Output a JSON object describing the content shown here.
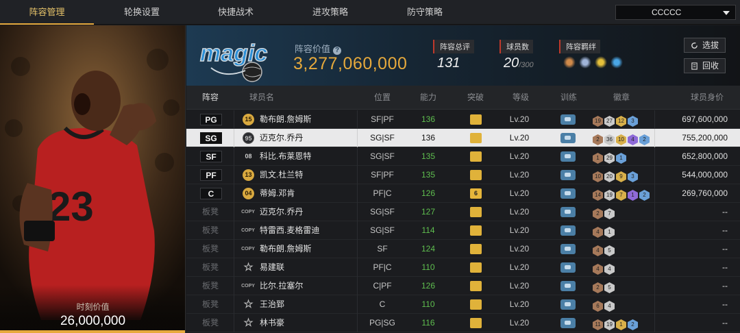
{
  "nav": {
    "tabs": [
      "阵容管理",
      "轮换设置",
      "快捷战术",
      "进攻策略",
      "防守策略"
    ],
    "active_tab": 0,
    "lineup_select": "CCCCC"
  },
  "left_card": {
    "title": "时刻价值",
    "value": "26,000,000",
    "jersey_number": "23"
  },
  "header": {
    "team_logo_text": "magic",
    "lineup_value_label": "阵容价值",
    "lineup_value": "3,277,060,000",
    "rating_label": "阵容总评",
    "rating_value": "131",
    "players_label": "球员数",
    "players_value": "20",
    "players_max": "/300",
    "chemistry_label": "阵容羁绊",
    "filter_button": "选拔",
    "recycle_button": "回收"
  },
  "table": {
    "columns": [
      "阵容",
      "球员名",
      "位置",
      "能力",
      "突破",
      "等级",
      "训练",
      "徽章",
      "球员身价"
    ],
    "rows": [
      {
        "slot": "PG",
        "starter": true,
        "badge": "15",
        "badge_style": "gold",
        "name": "勒布朗.詹姆斯",
        "pos": "SF|PF",
        "ability": "136",
        "break": "",
        "level": "Lv.20",
        "emblems": [
          "19",
          "27",
          "12",
          "3"
        ],
        "emblem_colors": [
          "#a6795a",
          "#c9c9c9",
          "#d8b04a",
          "#6aa0d8"
        ],
        "value": "697,600,000"
      },
      {
        "slot": "SG",
        "starter": true,
        "selected": true,
        "badge": "95",
        "badge_style": "dark",
        "name": "迈克尔.乔丹",
        "pos": "SG|SF",
        "ability": "136",
        "break": "",
        "level": "Lv.20",
        "emblems": [
          "2",
          "36",
          "10",
          "4",
          "2"
        ],
        "emblem_colors": [
          "#a6795a",
          "#c9c9c9",
          "#d8b04a",
          "#8e6ad8",
          "#6aa0d8"
        ],
        "value": "755,200,000"
      },
      {
        "slot": "SF",
        "starter": true,
        "badge": "08",
        "badge_style": "plain",
        "name": "科比.布莱恩特",
        "pos": "SG|SF",
        "ability": "135",
        "break": "",
        "level": "Lv.20",
        "emblems": [
          "1",
          "29",
          "1"
        ],
        "emblem_colors": [
          "#a6795a",
          "#c9c9c9",
          "#6aa0d8"
        ],
        "value": "652,800,000"
      },
      {
        "slot": "PF",
        "starter": true,
        "badge": "13",
        "badge_style": "gold",
        "name": "凯文.杜兰特",
        "pos": "SF|PF",
        "ability": "135",
        "break": "",
        "level": "Lv.20",
        "emblems": [
          "10",
          "20",
          "9",
          "3"
        ],
        "emblem_colors": [
          "#a6795a",
          "#c9c9c9",
          "#d8b04a",
          "#6aa0d8"
        ],
        "value": "544,000,000"
      },
      {
        "slot": "C",
        "starter": true,
        "badge": "04",
        "badge_style": "gold",
        "name": "蒂姆.邓肯",
        "pos": "PF|C",
        "ability": "126",
        "break": "6",
        "level": "Lv.20",
        "emblems": [
          "14",
          "19",
          "7",
          "1",
          "2"
        ],
        "emblem_colors": [
          "#a6795a",
          "#c9c9c9",
          "#d8b04a",
          "#8e6ad8",
          "#6aa0d8"
        ],
        "value": "269,760,000"
      },
      {
        "slot": "板凳",
        "starter": false,
        "badge": "COPY",
        "badge_style": "copy",
        "name": "迈克尔.乔丹",
        "pos": "SG|SF",
        "ability": "127",
        "break": "",
        "level": "Lv.20",
        "emblems": [
          "2",
          "7"
        ],
        "emblem_colors": [
          "#a6795a",
          "#c9c9c9"
        ],
        "value": "--"
      },
      {
        "slot": "板凳",
        "starter": false,
        "badge": "COPY",
        "badge_style": "copy",
        "name": "特雷西.麦格雷迪",
        "pos": "SG|SF",
        "ability": "114",
        "break": "",
        "level": "Lv.20",
        "emblems": [
          "4",
          "1"
        ],
        "emblem_colors": [
          "#a6795a",
          "#c9c9c9"
        ],
        "value": "--"
      },
      {
        "slot": "板凳",
        "starter": false,
        "badge": "COPY",
        "badge_style": "copy",
        "name": "勒布朗.詹姆斯",
        "pos": "SF",
        "ability": "124",
        "break": "",
        "level": "Lv.20",
        "emblems": [
          "4",
          "5"
        ],
        "emblem_colors": [
          "#a6795a",
          "#c9c9c9"
        ],
        "value": "--"
      },
      {
        "slot": "板凳",
        "starter": false,
        "badge": "☆",
        "badge_style": "star",
        "name": "易建联",
        "pos": "PF|C",
        "ability": "110",
        "break": "",
        "level": "Lv.20",
        "emblems": [
          "4",
          "4"
        ],
        "emblem_colors": [
          "#a6795a",
          "#c9c9c9"
        ],
        "value": "--"
      },
      {
        "slot": "板凳",
        "starter": false,
        "badge": "COPY",
        "badge_style": "copy",
        "name": "比尔.拉塞尔",
        "pos": "C|PF",
        "ability": "126",
        "break": "",
        "level": "Lv.20",
        "emblems": [
          "2",
          "5"
        ],
        "emblem_colors": [
          "#a6795a",
          "#c9c9c9"
        ],
        "value": "--"
      },
      {
        "slot": "板凳",
        "starter": false,
        "badge": "☆",
        "badge_style": "star",
        "name": "王治郅",
        "pos": "C",
        "ability": "110",
        "break": "",
        "level": "Lv.20",
        "emblems": [
          "6",
          "4"
        ],
        "emblem_colors": [
          "#a6795a",
          "#c9c9c9"
        ],
        "value": "--"
      },
      {
        "slot": "板凳",
        "starter": false,
        "badge": "☆",
        "badge_style": "star",
        "name": "林书豪",
        "pos": "PG|SG",
        "ability": "116",
        "break": "",
        "level": "Lv.20",
        "emblems": [
          "11",
          "19",
          "1",
          "2"
        ],
        "emblem_colors": [
          "#a6795a",
          "#c9c9c9",
          "#d8b04a",
          "#6aa0d8"
        ],
        "value": "--"
      }
    ]
  }
}
